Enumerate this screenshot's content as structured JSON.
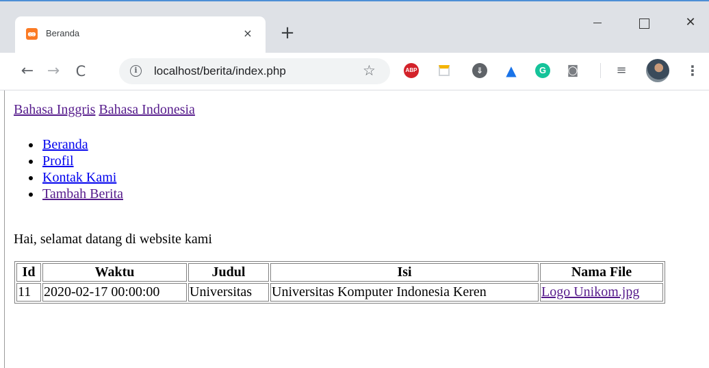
{
  "browser": {
    "tab_title": "Beranda",
    "tab_favicon": "xampp-icon",
    "tab_close": "×",
    "new_tab": "+",
    "window_controls": {
      "minimize": "minimize-icon",
      "maximize": "maximize-icon",
      "close": "✕"
    },
    "url": "localhost/berita/index.php",
    "nav_icons": {
      "back": "←",
      "forward": "→",
      "reload": "C"
    },
    "info_glyph": "i",
    "star_glyph": "☆",
    "extensions": [
      {
        "name": "adblock-plus-icon",
        "text": "ABP"
      },
      {
        "name": "note-extension-icon"
      },
      {
        "name": "download-extension-icon",
        "text": "⇓"
      },
      {
        "name": "graduation-cap-icon",
        "text": "🎓"
      },
      {
        "name": "grammarly-icon",
        "text": "G"
      },
      {
        "name": "camera-icon",
        "text": "📷"
      },
      {
        "name": "media-control-icon",
        "text": "≡"
      }
    ],
    "menu_glyph": "⋮",
    "colors": {
      "titlebar": "#dee1e6",
      "accent_border": "#4d8fd6",
      "visited_link": "#551a8b",
      "link": "#0000ee"
    }
  },
  "page": {
    "lang_links": {
      "english": "Bahasa Inggris",
      "indonesian": "Bahasa Indonesia"
    },
    "nav": [
      {
        "label": "Beranda"
      },
      {
        "label": "Profil"
      },
      {
        "label": "Kontak Kami"
      },
      {
        "label": "Tambah Berita"
      }
    ],
    "welcome": "Hai, selamat datang di website kami",
    "table": {
      "headers": [
        "Id",
        "Waktu",
        "Judul",
        "Isi",
        "Nama File"
      ],
      "rows": [
        {
          "id": "11",
          "waktu": "2020-02-17 00:00:00",
          "judul": "Universitas",
          "isi": "Universitas Komputer Indonesia Keren",
          "nama_file": "Logo Unikom.jpg"
        }
      ]
    }
  }
}
